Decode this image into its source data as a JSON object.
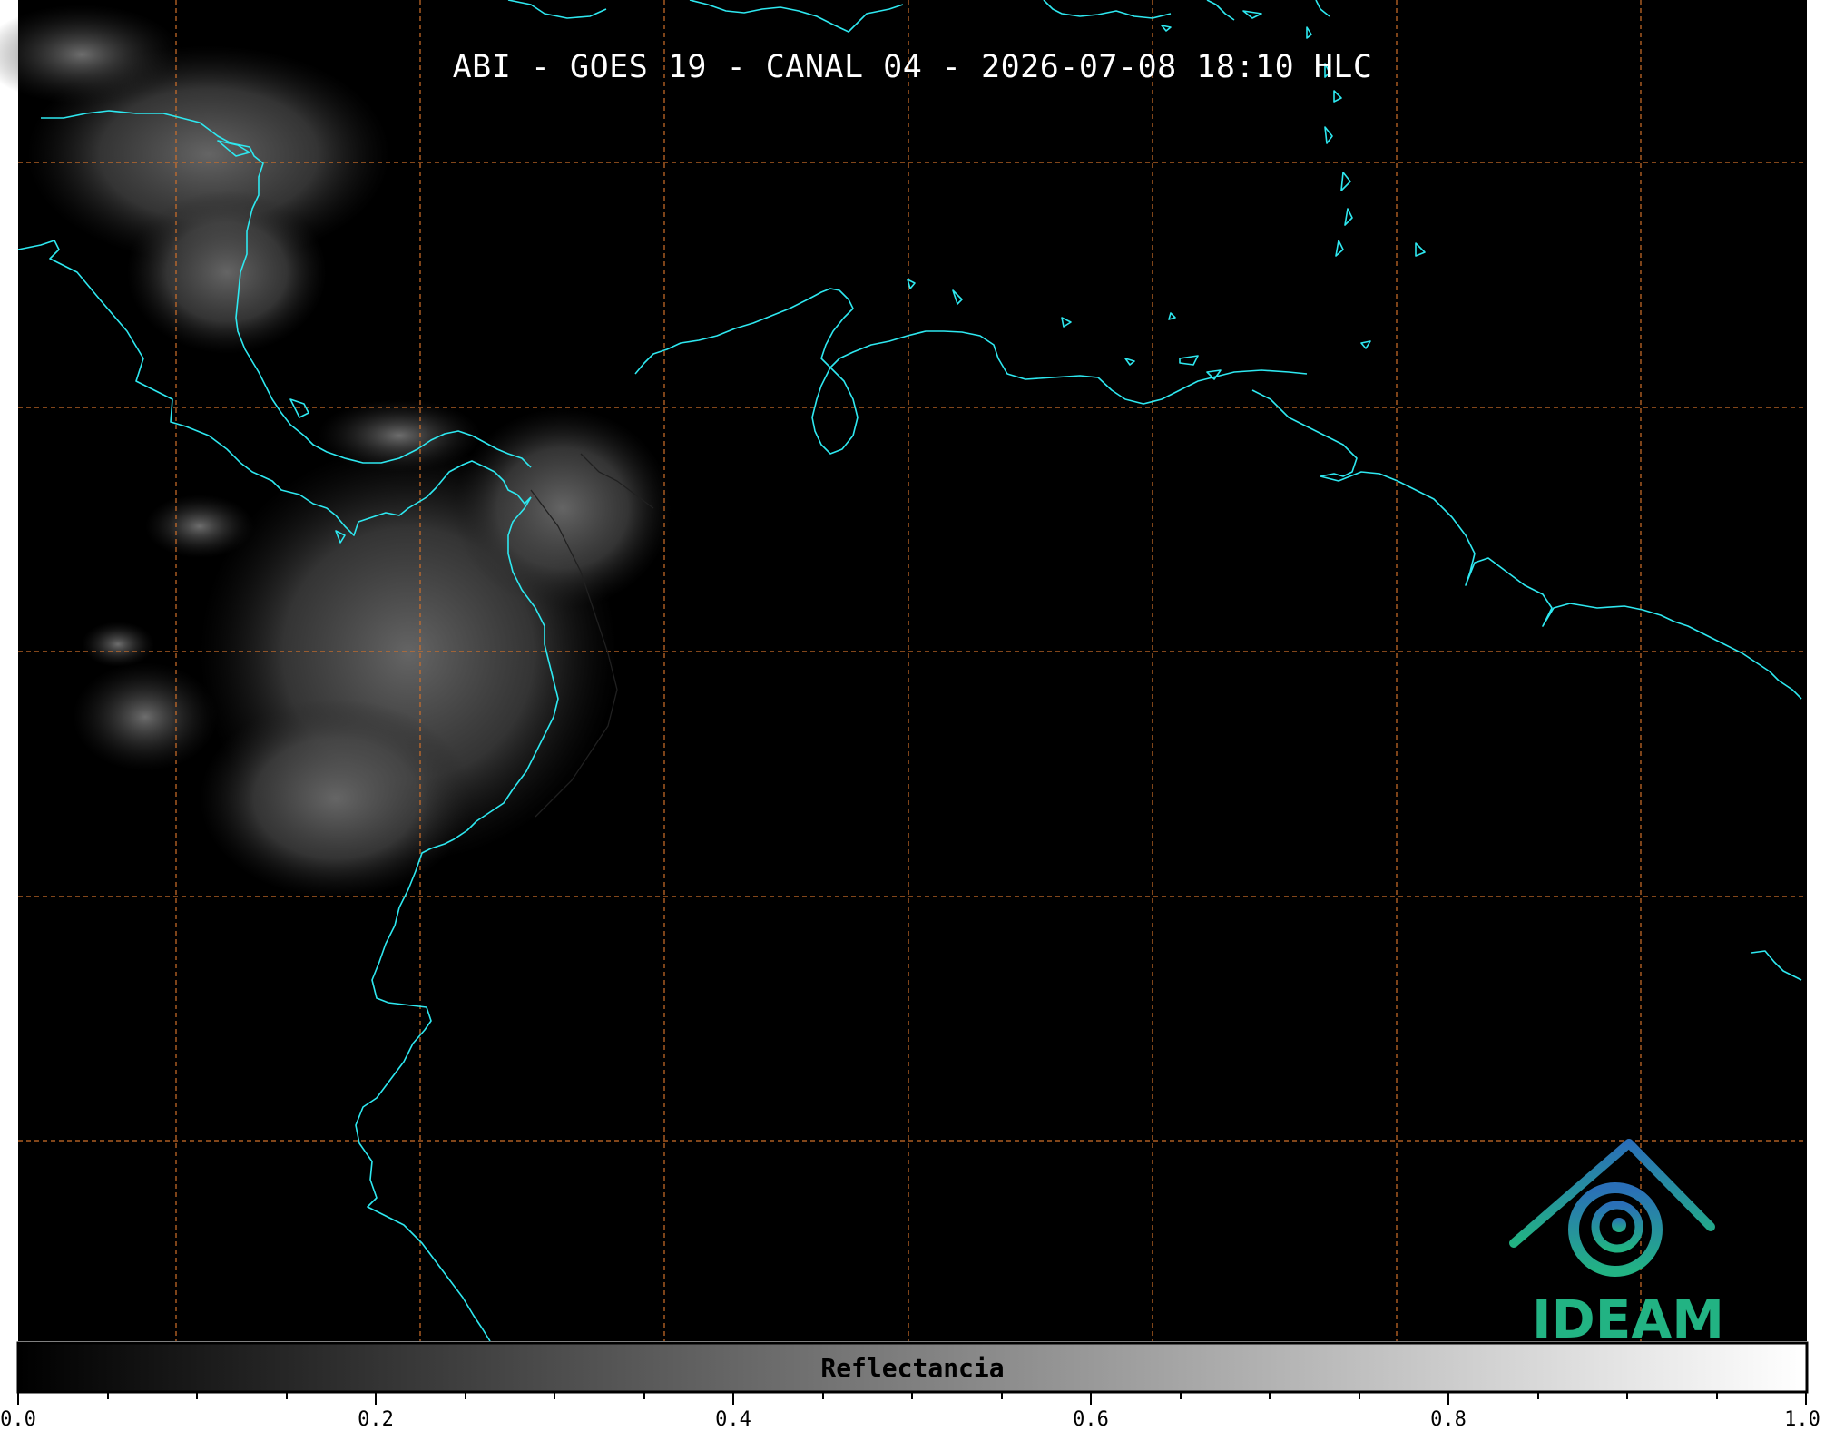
{
  "title": "ABI - GOES 19 - CANAL 04 - 2026-07-08 18:10 HLC",
  "logo": {
    "text": "IDEAM",
    "color": "#22b383",
    "symbol_color": "#2a7fb0"
  },
  "colorbar": {
    "label": "Reflectancia",
    "min": 0.0,
    "max": 1.0,
    "tick_labels": [
      "0.0",
      "0.2",
      "0.4",
      "0.6",
      "0.8",
      "1.0"
    ],
    "minor_ticks_per_major": 4,
    "colormap": [
      "#000000",
      "#ffffff"
    ]
  },
  "map": {
    "background": "#000000",
    "coastline_color": "#2ee8f0",
    "grid_color": "#d0702a",
    "grid_style": "dashed"
  }
}
